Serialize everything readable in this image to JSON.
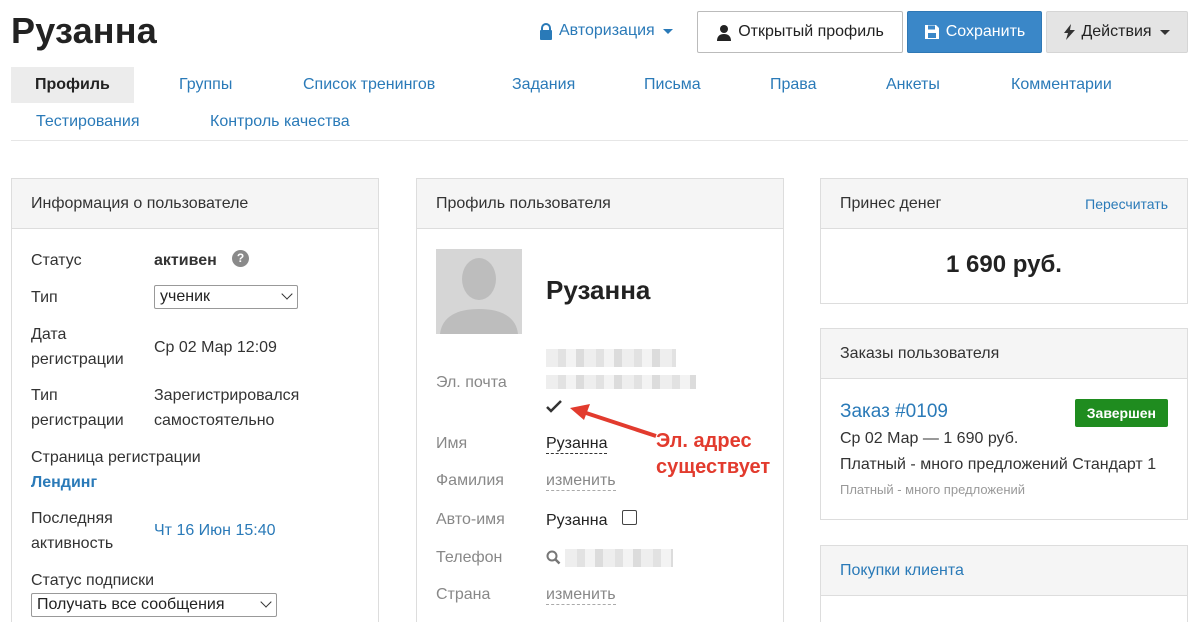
{
  "page": {
    "title": "Рузанна"
  },
  "header": {
    "auth_label": "Авторизация",
    "open_profile_label": "Открытый профиль",
    "save_label": "Сохранить",
    "actions_label": "Действия"
  },
  "tabs": [
    {
      "label": "Профиль",
      "active": true
    },
    {
      "label": "Группы"
    },
    {
      "label": "Список тренингов"
    },
    {
      "label": "Задания"
    },
    {
      "label": "Письма"
    },
    {
      "label": "Права"
    },
    {
      "label": "Анкеты"
    },
    {
      "label": "Комментарии"
    },
    {
      "label": "Тестирования"
    },
    {
      "label": "Контроль качества"
    }
  ],
  "info": {
    "title": "Информация о пользователе",
    "status_label": "Статус",
    "status_value": "активен",
    "type_label": "Тип",
    "type_value": "ученик",
    "reg_date_label_1": "Дата",
    "reg_date_label_2": "регистрации",
    "reg_date_value": "Ср 02 Мар 12:09",
    "reg_type_label_1": "Тип",
    "reg_type_label_2": "регистрации",
    "reg_type_value_1": "Зарегистрировался",
    "reg_type_value_2": "самостоятельно",
    "reg_page_label": "Страница регистрации",
    "reg_page_value": "Лендинг",
    "last_activity_label_1": "Последняя",
    "last_activity_label_2": "активность",
    "last_activity_value": "Чт 16 Июн 15:40",
    "subscription_label": "Статус подписки",
    "subscription_value": "Получать все сообщения"
  },
  "profile": {
    "title": "Профиль пользователя",
    "name": "Рузанна",
    "email_label": "Эл. почта",
    "first_name_label": "Имя",
    "first_name_value": "Рузанна",
    "last_name_label": "Фамилия",
    "last_name_value": "изменить",
    "auto_name_label": "Авто-имя",
    "auto_name_value": "Рузанна",
    "phone_label": "Телефон",
    "country_label": "Страна",
    "country_value": "изменить"
  },
  "money": {
    "title": "Принес денег",
    "recalc_label": "Пересчитать",
    "value": "1 690 руб."
  },
  "orders": {
    "title": "Заказы пользователя",
    "order_label": "Заказ #0109",
    "status_badge": "Завершен",
    "line1": "Ср 02 Мар — 1 690 руб.",
    "line2": "Платный - много предложений Стандарт 1",
    "line3": "Платный - много предложений"
  },
  "purchases": {
    "title": "Покупки клиента"
  },
  "annotation": {
    "line1": "Эл. адрес",
    "line2": "существует",
    "color": "#e23b2e"
  },
  "colors": {
    "accent": "#2a7ab8",
    "save": "#3a87c8",
    "success": "#1f8c1f"
  }
}
